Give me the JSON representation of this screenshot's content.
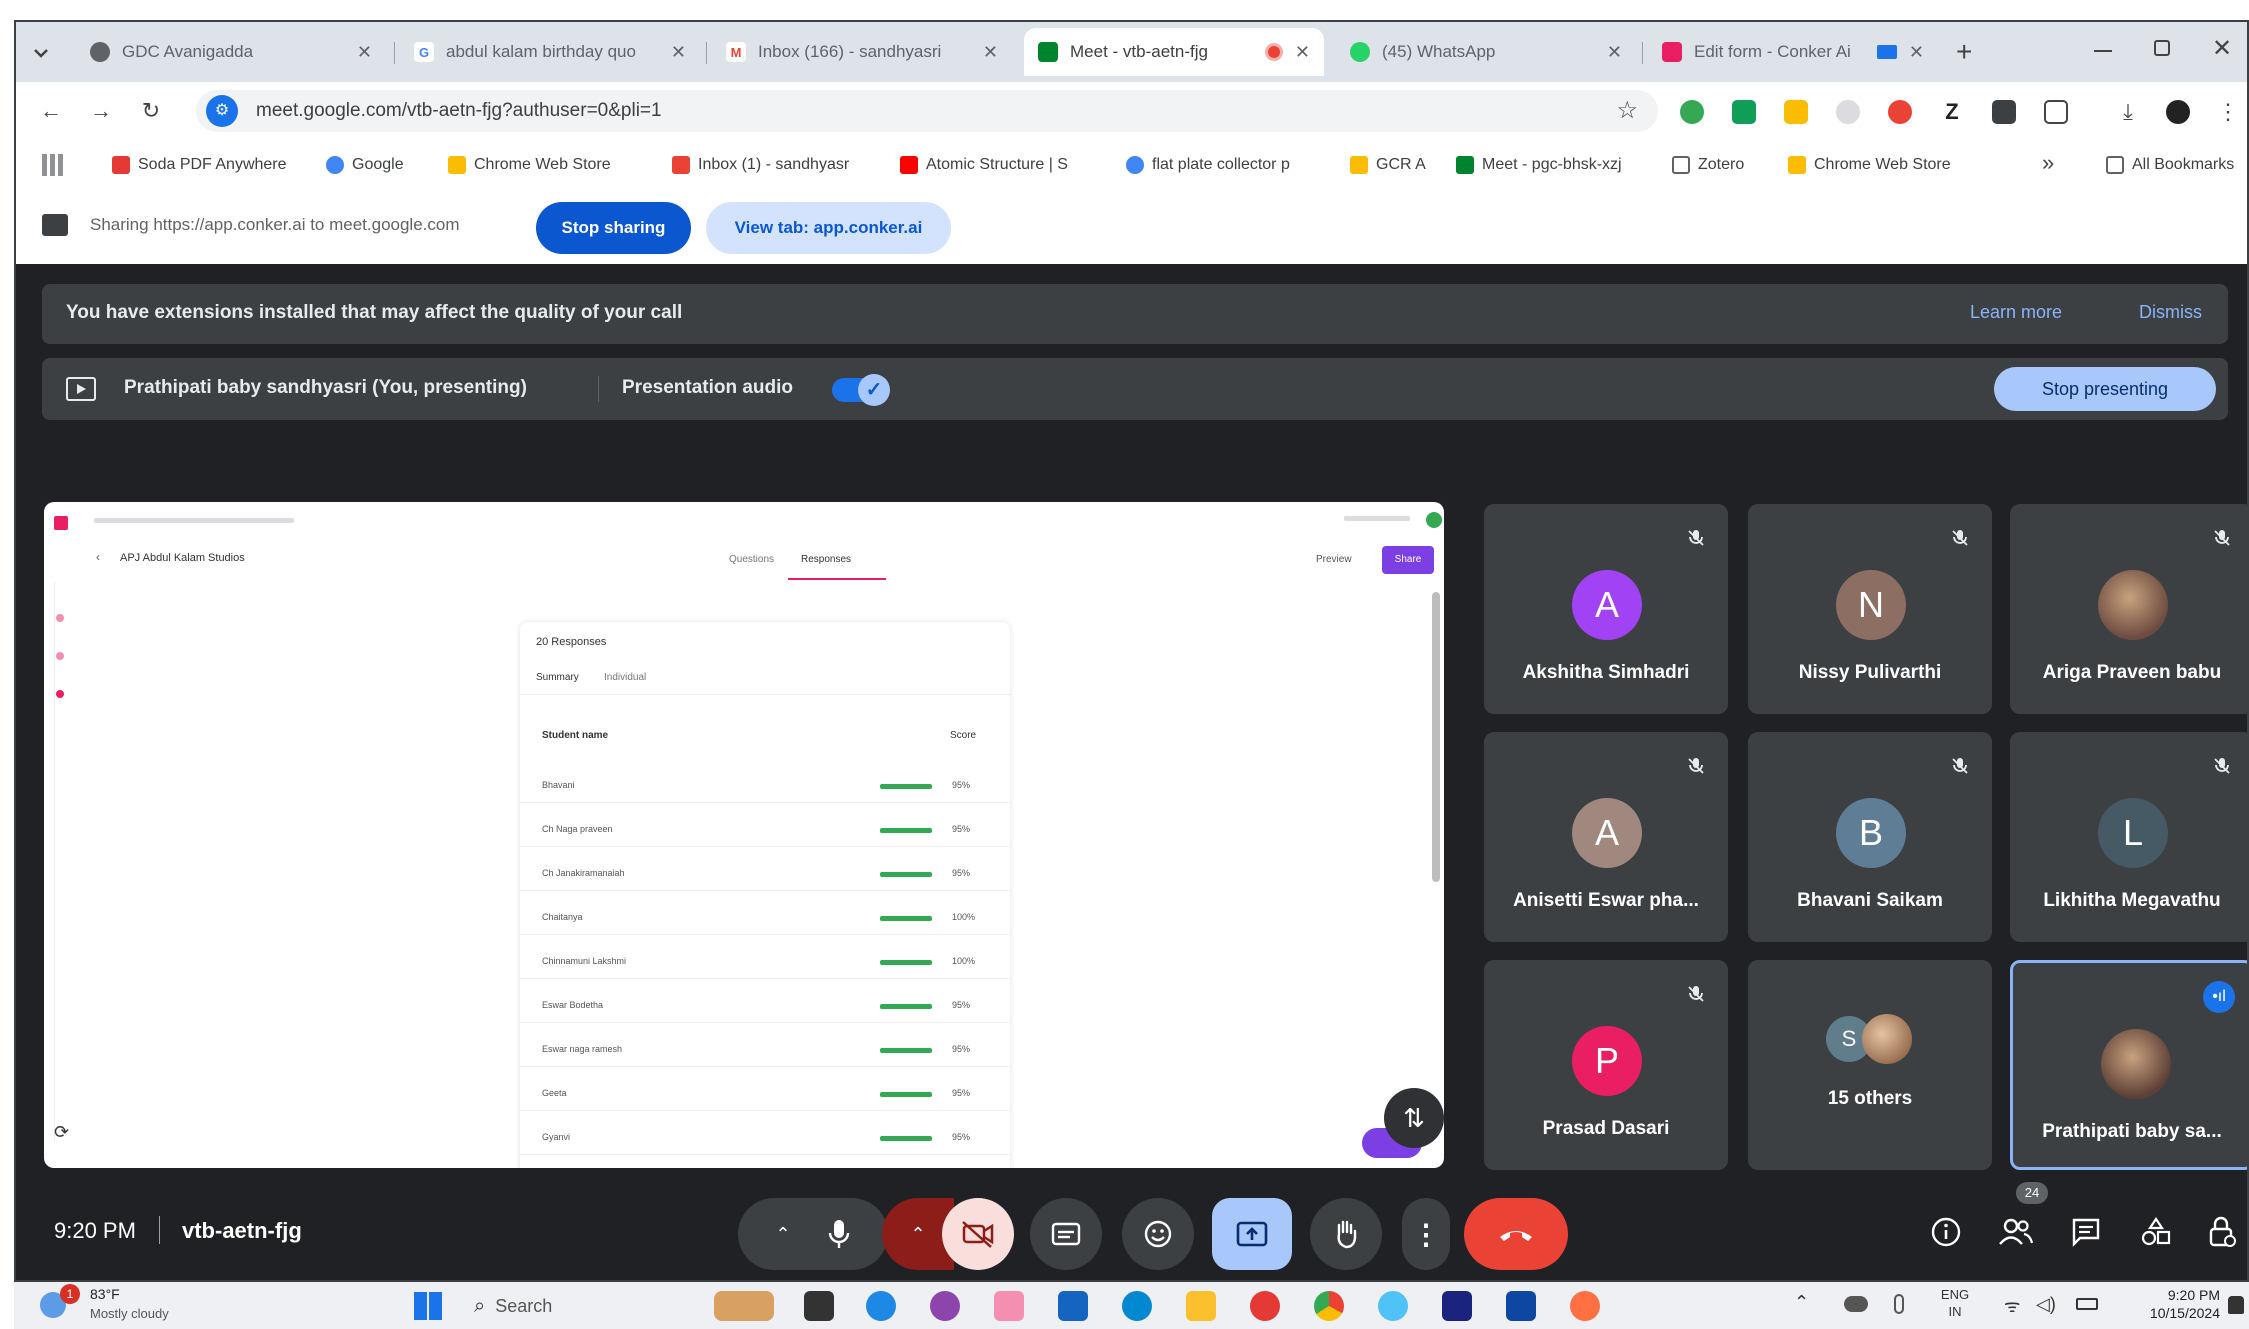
{
  "tabs": [
    {
      "title": "GDC Avanigadda",
      "color": "#5f6368",
      "glyph": ""
    },
    {
      "title": "abdul kalam birthday quo",
      "color": "#4285f4",
      "glyph": "G"
    },
    {
      "title": "Inbox (166) - sandhyasri",
      "color": "#ea4335",
      "glyph": "M"
    },
    {
      "title": "Meet - vtb-aetn-fjg",
      "color": "#00832d",
      "glyph": ""
    },
    {
      "title": "(45) WhatsApp",
      "color": "#25d366",
      "glyph": ""
    },
    {
      "title": "Edit form - Conker Ai",
      "color": "#e91e63",
      "glyph": ""
    }
  ],
  "omnibox": {
    "url": "meet.google.com/vtb-aetn-fjg?authuser=0&pli=1"
  },
  "bookmarks": [
    "Soda PDF Anywhere",
    "Google",
    "Chrome Web Store",
    "Inbox (1) - sandhyasr",
    "Atomic Structure | S",
    "flat plate collector p",
    "GCR A",
    "Meet - pgc-bhsk-xzj",
    "Zotero",
    "Chrome Web Store"
  ],
  "all_bookmarks": "All Bookmarks",
  "sharing": {
    "text": "Sharing https://app.conker.ai to meet.google.com",
    "stop_label": "Stop sharing",
    "view_label": "View tab: app.conker.ai"
  },
  "warning": {
    "text": "You have extensions installed that may affect the quality of your call",
    "learn_more": "Learn more",
    "dismiss": "Dismiss"
  },
  "presenting": {
    "name": "Prathipati baby sandhyasri (You, presenting)",
    "audio_label": "Presentation audio",
    "stop_label": "Stop presenting"
  },
  "shared_content": {
    "form_title": "APJ Abdul Kalam Studios",
    "tab_questions": "Questions",
    "tab_responses": "Responses",
    "preview": "Preview",
    "share": "Share",
    "responses_count": "20 Responses",
    "sub_summary": "Summary",
    "sub_individual": "Individual",
    "col_student": "Student name",
    "col_score": "Score",
    "rows": [
      {
        "name": "Bhavani",
        "score": "95%"
      },
      {
        "name": "Ch Naga praveen",
        "score": "95%"
      },
      {
        "name": "Ch Janakiramanaiah",
        "score": "95%"
      },
      {
        "name": "Chaitanya",
        "score": "100%"
      },
      {
        "name": "Chinnamuni Lakshmi",
        "score": "100%"
      },
      {
        "name": "Eswar Bodetha",
        "score": "95%"
      },
      {
        "name": "Eswar naga ramesh",
        "score": "95%"
      },
      {
        "name": "Geeta",
        "score": "95%"
      },
      {
        "name": "Gyanvi",
        "score": "95%"
      }
    ]
  },
  "participants": [
    {
      "name": "Akshitha Simhadri",
      "initial": "A",
      "color": "#a142f4"
    },
    {
      "name": "Nissy Pulivarthi",
      "initial": "N",
      "color": "#8d6e63"
    },
    {
      "name": "Ariga Praveen babu",
      "initial": "",
      "color": "#6d4c41"
    },
    {
      "name": "Anisetti Eswar pha...",
      "initial": "A",
      "color": "#a1887f"
    },
    {
      "name": "Bhavani Saikam",
      "initial": "B",
      "color": "#5f7d95"
    },
    {
      "name": "Likhitha Megavathu",
      "initial": "L",
      "color": "#455a64"
    },
    {
      "name": "Prasad Dasari",
      "initial": "P",
      "color": "#e91e63"
    },
    {
      "name": "15 others",
      "initial": "S",
      "color": "#607d8b"
    },
    {
      "name": "Prathipati baby sa...",
      "initial": "",
      "color": "#5d4037"
    }
  ],
  "controls": {
    "time": "9:20 PM",
    "meeting_code": "vtb-aetn-fjg",
    "participant_count": "24"
  },
  "taskbar": {
    "weather_temp": "83°F",
    "weather_desc": "Mostly cloudy",
    "search": "Search",
    "lang": "ENG",
    "region": "IN",
    "time": "9:20 PM",
    "date": "10/15/2024",
    "badge": "1"
  },
  "colors": {
    "meet_bg": "#202124",
    "tile_bg": "#3c4043",
    "accent": "#0b57d0",
    "end_call": "#ea4335"
  }
}
